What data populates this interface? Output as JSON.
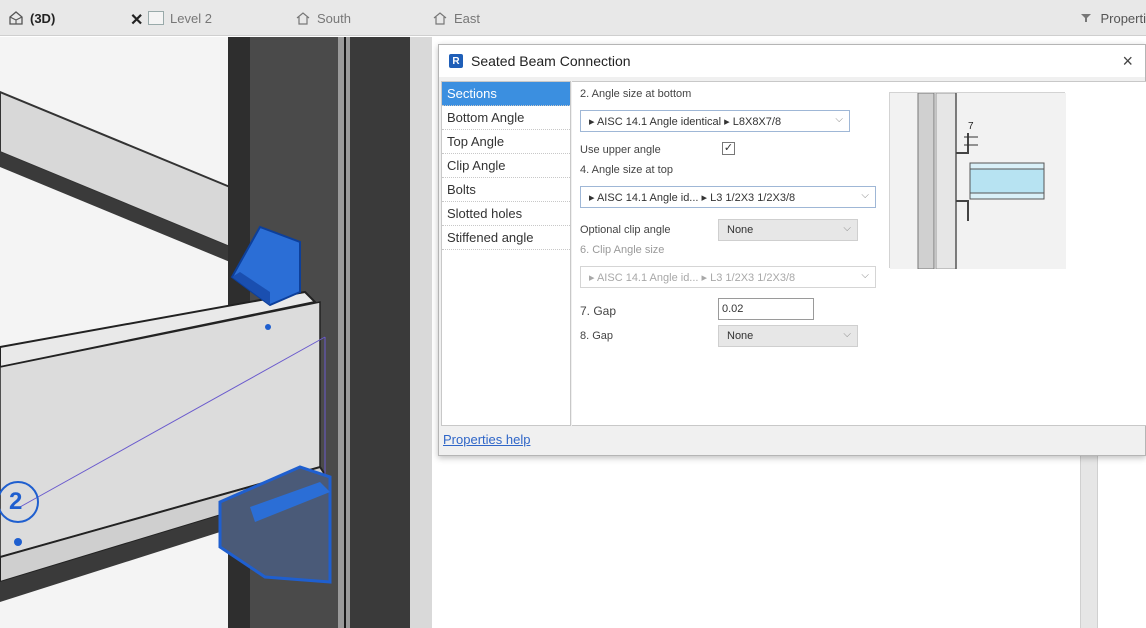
{
  "tabs": {
    "view3d": "(3D)",
    "level2": "Level 2",
    "south": "South",
    "east": "East",
    "properties": "Properti"
  },
  "viewport": {
    "grid_bubble": "2"
  },
  "dialog": {
    "title": "Seated Beam Connection",
    "close": "×",
    "nav": [
      "Sections",
      "Bottom Angle",
      "Top Angle",
      "Clip Angle",
      "Bolts",
      "Slotted holes",
      "Stiffened angle"
    ],
    "active_nav": "Sections",
    "fields": {
      "angle_bottom_label": "2. Angle size at bottom",
      "angle_bottom_value": "▸ AISC 14.1 Angle identical  ▸  L8X8X7/8",
      "use_upper_label": "Use upper angle",
      "use_upper_checked": "✓",
      "angle_top_label": "4. Angle size at top",
      "angle_top_value": "▸ AISC 14.1 Angle id...  ▸  L3 1/2X3 1/2X3/8",
      "clip_angle_label": "Optional clip angle",
      "clip_angle_value": "None",
      "clip_size_label": "6. Clip Angle size",
      "clip_size_value": "▸ AISC 14.1 Angle id...  ▸  L3 1/2X3 1/2X3/8",
      "gap7_label": "7. Gap",
      "gap7_value": "0.02",
      "gap8_label": "8. Gap",
      "gap8_value": "None"
    },
    "preview_dim": "7",
    "help_link": "Properties help"
  },
  "colors": {
    "accent": "#3b8fe0",
    "connection_blue": "#1f5fcf"
  }
}
